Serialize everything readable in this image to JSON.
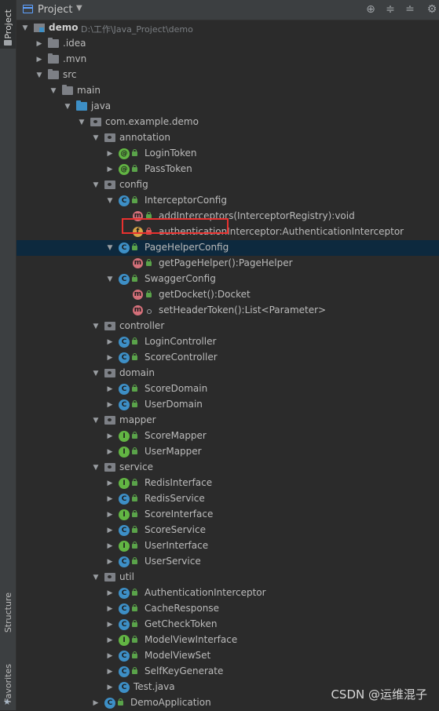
{
  "side_tabs": {
    "project": "Project",
    "structure": "Structure",
    "favorites": "Favorites"
  },
  "header": {
    "title": "Project",
    "icons": [
      "locate-icon",
      "expand-all-icon",
      "collapse-all-icon",
      "settings-icon"
    ]
  },
  "tree": [
    {
      "label": "demo",
      "path": "D:\\工作\\Java_Project\\demo",
      "icon": "module-folder",
      "arrow": "down"
    },
    {
      "label": ".idea",
      "icon": "folder",
      "arrow": "right"
    },
    {
      "label": ".mvn",
      "icon": "folder",
      "arrow": "right"
    },
    {
      "label": "src",
      "icon": "folder",
      "arrow": "down"
    },
    {
      "label": "main",
      "icon": "folder",
      "arrow": "down"
    },
    {
      "label": "java",
      "icon": "source-folder",
      "arrow": "down"
    },
    {
      "label": "com.example.demo",
      "icon": "package",
      "arrow": "down"
    },
    {
      "label": "annotation",
      "icon": "package",
      "arrow": "down"
    },
    {
      "label": "LoginToken",
      "icon": "annotation",
      "arrow": "right"
    },
    {
      "label": "PassToken",
      "icon": "annotation",
      "arrow": "right"
    },
    {
      "label": "config",
      "icon": "package",
      "arrow": "down"
    },
    {
      "label": "InterceptorConfig",
      "icon": "class",
      "arrow": "down"
    },
    {
      "label": "addInterceptors(InterceptorRegistry):void",
      "icon": "method"
    },
    {
      "label": "authenticationInterceptor:AuthenticationInterceptor",
      "icon": "field"
    },
    {
      "label": "PageHelperConfig",
      "icon": "class",
      "arrow": "down"
    },
    {
      "label": "getPageHelper():PageHelper",
      "icon": "method"
    },
    {
      "label": "SwaggerConfig",
      "icon": "class",
      "arrow": "down"
    },
    {
      "label": "getDocket():Docket",
      "icon": "method"
    },
    {
      "label": "setHeaderToken():List<Parameter>",
      "icon": "method"
    },
    {
      "label": "controller",
      "icon": "package",
      "arrow": "down"
    },
    {
      "label": "LoginController",
      "icon": "class",
      "arrow": "right"
    },
    {
      "label": "ScoreController",
      "icon": "class",
      "arrow": "right"
    },
    {
      "label": "domain",
      "icon": "package",
      "arrow": "down"
    },
    {
      "label": "ScoreDomain",
      "icon": "class",
      "arrow": "right"
    },
    {
      "label": "UserDomain",
      "icon": "class",
      "arrow": "right"
    },
    {
      "label": "mapper",
      "icon": "package",
      "arrow": "down"
    },
    {
      "label": "ScoreMapper",
      "icon": "interface",
      "arrow": "right"
    },
    {
      "label": "UserMapper",
      "icon": "interface",
      "arrow": "right"
    },
    {
      "label": "service",
      "icon": "package",
      "arrow": "down"
    },
    {
      "label": "RedisInterface",
      "icon": "interface",
      "arrow": "right"
    },
    {
      "label": "RedisService",
      "icon": "class",
      "arrow": "right"
    },
    {
      "label": "ScoreInterface",
      "icon": "interface",
      "arrow": "right"
    },
    {
      "label": "ScoreService",
      "icon": "class",
      "arrow": "right"
    },
    {
      "label": "UserInterface",
      "icon": "interface",
      "arrow": "right"
    },
    {
      "label": "UserService",
      "icon": "class",
      "arrow": "right"
    },
    {
      "label": "util",
      "icon": "package",
      "arrow": "down"
    },
    {
      "label": "AuthenticationInterceptor",
      "icon": "class",
      "arrow": "right"
    },
    {
      "label": "CacheResponse",
      "icon": "class",
      "arrow": "right"
    },
    {
      "label": "GetCheckToken",
      "icon": "class",
      "arrow": "right"
    },
    {
      "label": "ModelViewInterface",
      "icon": "interface",
      "arrow": "right"
    },
    {
      "label": "ModelViewSet",
      "icon": "class",
      "arrow": "right"
    },
    {
      "label": "SelfKeyGenerate",
      "icon": "class",
      "arrow": "right"
    },
    {
      "label": "Test.java",
      "icon": "java-file",
      "arrow": "right"
    },
    {
      "label": "DemoApplication",
      "icon": "app-class",
      "arrow": "right"
    }
  ],
  "watermark": "CSDN @运维混子",
  "colors": {
    "background": "#2b2b2b",
    "selection": "#0d293e",
    "highlight_box": "#e8312f",
    "class_icon": "#3d8fc6",
    "interface_icon": "#62b543"
  }
}
